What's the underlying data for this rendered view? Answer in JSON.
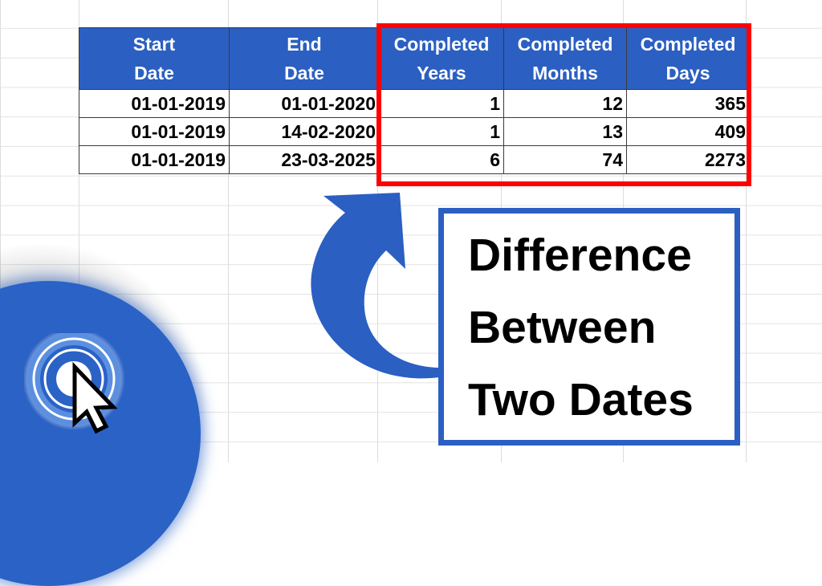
{
  "table": {
    "headers": [
      [
        "Start",
        "Date"
      ],
      [
        "End",
        "Date"
      ],
      [
        "Completed",
        "Years"
      ],
      [
        "Completed",
        "Months"
      ],
      [
        "Completed",
        "Days"
      ]
    ],
    "rows": [
      [
        "01-01-2019",
        "01-01-2020",
        "1",
        "12",
        "365"
      ],
      [
        "01-01-2019",
        "14-02-2020",
        "1",
        "13",
        "409"
      ],
      [
        "01-01-2019",
        "23-03-2025",
        "6",
        "74",
        "2273"
      ]
    ]
  },
  "title": {
    "lines": [
      "Difference",
      "Between",
      "Two Dates"
    ]
  },
  "icons": {
    "arrow": "curved-arrow-icon",
    "logo": "click-cursor-icon"
  },
  "colors": {
    "header_blue": "#2b5fc2",
    "highlight_red": "#ff0000",
    "accent_blue": "#2b62c6"
  }
}
